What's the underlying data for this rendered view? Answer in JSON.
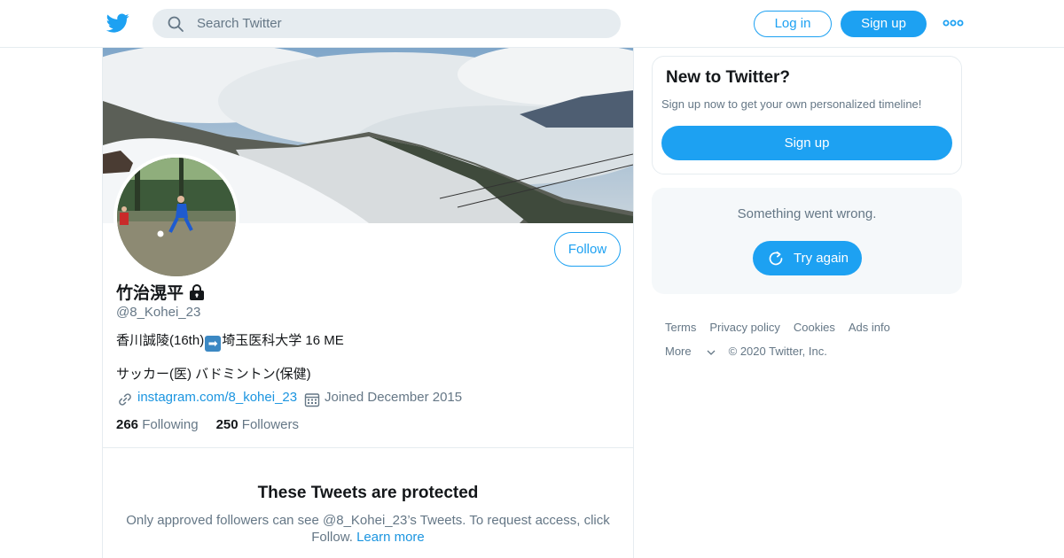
{
  "nav": {
    "search_placeholder": "Search Twitter",
    "login_label": "Log in",
    "signup_label": "Sign up"
  },
  "profile": {
    "name": "竹治滉平",
    "handle": "@8_Kohei_23",
    "bio_part1": "香川誠陵(16th)",
    "bio_arrow": "➡",
    "bio_part2": "埼玉医科大学 16 ME",
    "bio_line2": "サッカー(医) バドミントン(保健)",
    "link": "instagram.com/8_kohei_23",
    "joined": "Joined December 2015",
    "following_count": "266",
    "following_label": "Following",
    "followers_count": "250",
    "followers_label": "Followers",
    "follow_label": "Follow"
  },
  "protected": {
    "title": "These Tweets are protected",
    "text": "Only approved followers can see @8_Kohei_23’s Tweets. To request access, click Follow.",
    "learn_more": "Learn more"
  },
  "sidebar": {
    "new_title": "New to Twitter?",
    "new_sub": "Sign up now to get your own personalized timeline!",
    "new_button": "Sign up",
    "error_msg": "Something went wrong.",
    "retry_label": "Try again"
  },
  "footer": {
    "terms": "Terms",
    "privacy": "Privacy policy",
    "cookies": "Cookies",
    "ads": "Ads info",
    "more": "More",
    "copyright": "© 2020 Twitter, Inc."
  },
  "colors": {
    "accent": "#1da1f2",
    "link": "#1b95e0",
    "secondary_text": "#657786",
    "border": "#e6ecf0"
  },
  "icons": [
    "twitter-bird-icon",
    "search-icon",
    "more-dots-icon",
    "lock-icon",
    "link-icon",
    "calendar-icon",
    "refresh-icon",
    "chevron-down-icon"
  ]
}
